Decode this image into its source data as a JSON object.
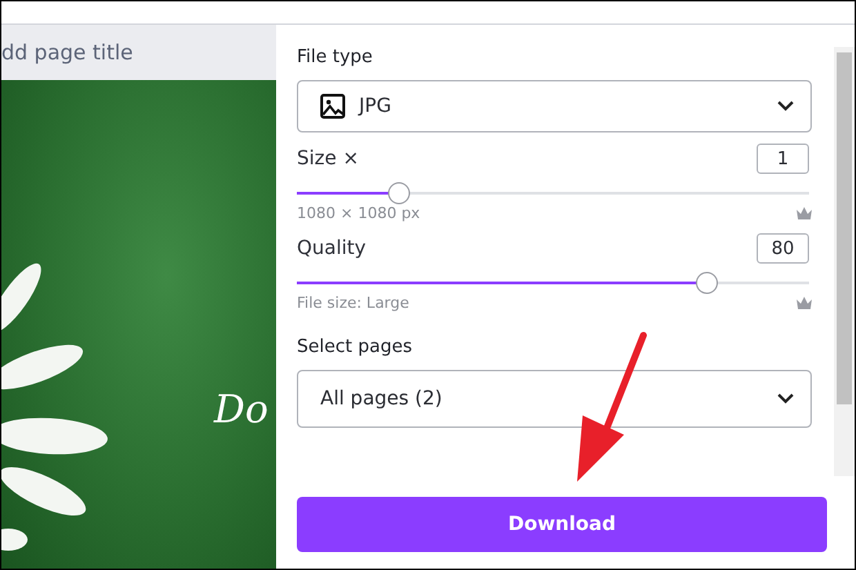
{
  "editor": {
    "page_title_placeholder": "dd page title",
    "canvas_text": "Do"
  },
  "download_panel": {
    "file_type": {
      "label": "File type",
      "value": "JPG"
    },
    "size": {
      "label": "Size ×",
      "value": "1",
      "level": 0.2,
      "caption": "1080 × 1080 px"
    },
    "quality": {
      "label": "Quality",
      "value": "80",
      "level": 0.8,
      "caption": "File size: Large"
    },
    "pages": {
      "label": "Select pages",
      "value": "All pages (2)"
    },
    "button": "Download"
  }
}
